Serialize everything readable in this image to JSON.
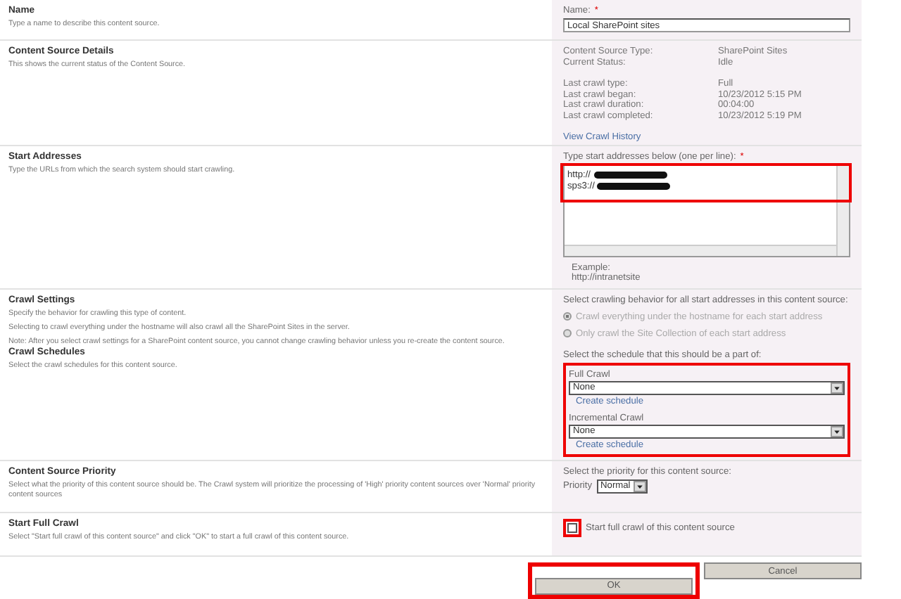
{
  "name_section": {
    "title": "Name",
    "description": "Type a name to describe this content source.",
    "field_label": "Name:",
    "required_mark": "*",
    "value": "Local SharePoint sites"
  },
  "details_section": {
    "title": "Content Source Details",
    "description": "This shows the current status of the Content Source.",
    "status_rows": [
      {
        "label": "Content Source Type:",
        "value": "SharePoint Sites"
      },
      {
        "label": "Current Status:",
        "value": "Idle"
      }
    ],
    "crawl_rows": [
      {
        "label": "Last crawl type:",
        "value": "Full"
      },
      {
        "label": "Last crawl began:",
        "value": "10/23/2012 5:15 PM"
      },
      {
        "label": "Last crawl duration:",
        "value": "00:04:00"
      },
      {
        "label": "Last crawl completed:",
        "value": "10/23/2012 5:19 PM"
      }
    ],
    "link": "View Crawl History"
  },
  "addresses_section": {
    "title": "Start Addresses",
    "description": "Type the URLs from which the search system should start crawling.",
    "field_label": "Type start addresses below (one per line):",
    "required_mark": "*",
    "lines": [
      "http://",
      "sps3://"
    ],
    "example_label": "Example:",
    "example": "http://intranetsite"
  },
  "settings_section": {
    "title": "Crawl Settings",
    "descriptions": [
      "Specify the behavior for crawling this type of content.",
      "Selecting to crawl everything under the hostname will also crawl all the SharePoint Sites in the server.",
      "Note: After you select crawl settings for a SharePoint content source, you cannot change crawling behavior unless you re-create the content source."
    ],
    "prompt": "Select crawling behavior for all start addresses in this content source:",
    "options": [
      {
        "label": "Crawl everything under the hostname for each start address",
        "selected": true,
        "disabled": true
      },
      {
        "label": "Only crawl the Site Collection of each start address",
        "selected": false,
        "disabled": true
      }
    ]
  },
  "schedules_section": {
    "title": "Crawl Schedules",
    "description": "Select the crawl schedules for this content source.",
    "prompt": "Select the schedule that this should be a part of:",
    "schedules": [
      {
        "label": "Full Crawl",
        "value": "None",
        "link": "Create schedule"
      },
      {
        "label": "Incremental Crawl",
        "value": "None",
        "link": "Create schedule"
      }
    ]
  },
  "priority_section": {
    "title": "Content Source Priority",
    "description": "Select what the priority of this content source should be. The Crawl system will prioritize the processing of 'High' priority content sources over 'Normal' priority content sources",
    "prompt": "Select the priority for this content source:",
    "field_label": "Priority",
    "value": "Normal"
  },
  "full_crawl_section": {
    "title": "Start Full Crawl",
    "description": "Select \"Start full crawl of this content source\" and click \"OK\" to start a full crawl of this content source.",
    "checkbox_label": "Start full crawl of this content source",
    "checked": false
  },
  "buttons": [
    "OK",
    "Cancel"
  ]
}
